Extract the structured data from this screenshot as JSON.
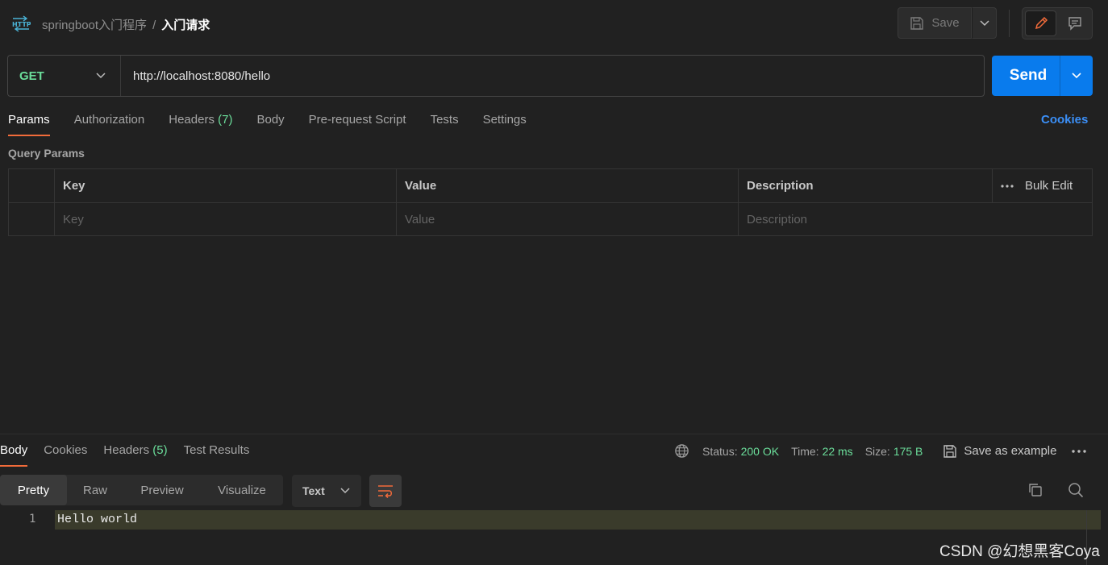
{
  "header": {
    "collection": "springboot入门程序",
    "separator": "/",
    "request_name": "入门请求",
    "save_label": "Save"
  },
  "request": {
    "method": "GET",
    "url": "http://localhost:8080/hello",
    "send_label": "Send"
  },
  "tabs": [
    {
      "label": "Params"
    },
    {
      "label": "Authorization"
    },
    {
      "label": "Headers",
      "count": "(7)"
    },
    {
      "label": "Body"
    },
    {
      "label": "Pre-request Script"
    },
    {
      "label": "Tests"
    },
    {
      "label": "Settings"
    }
  ],
  "cookies_link": "Cookies",
  "query_params": {
    "title": "Query Params",
    "headers": {
      "key": "Key",
      "value": "Value",
      "description": "Description",
      "bulk_edit": "Bulk Edit"
    },
    "placeholders": {
      "key": "Key",
      "value": "Value",
      "description": "Description"
    }
  },
  "response": {
    "tabs": [
      {
        "label": "Body"
      },
      {
        "label": "Cookies"
      },
      {
        "label": "Headers",
        "count": "(5)"
      },
      {
        "label": "Test Results"
      }
    ],
    "status_label": "Status:",
    "status_value": "200 OK",
    "time_label": "Time:",
    "time_value": "22 ms",
    "size_label": "Size:",
    "size_value": "175 B",
    "save_example": "Save as example",
    "view_modes": [
      "Pretty",
      "Raw",
      "Preview",
      "Visualize"
    ],
    "format": "Text",
    "lines": [
      {
        "number": "1",
        "text": "Hello world"
      }
    ]
  },
  "watermark": "CSDN @幻想黑客Coya",
  "colors": {
    "accent_orange": "#f26b3a",
    "send_blue": "#097bed",
    "success_green": "#6bdd9a",
    "link_blue": "#3b8ff7"
  }
}
